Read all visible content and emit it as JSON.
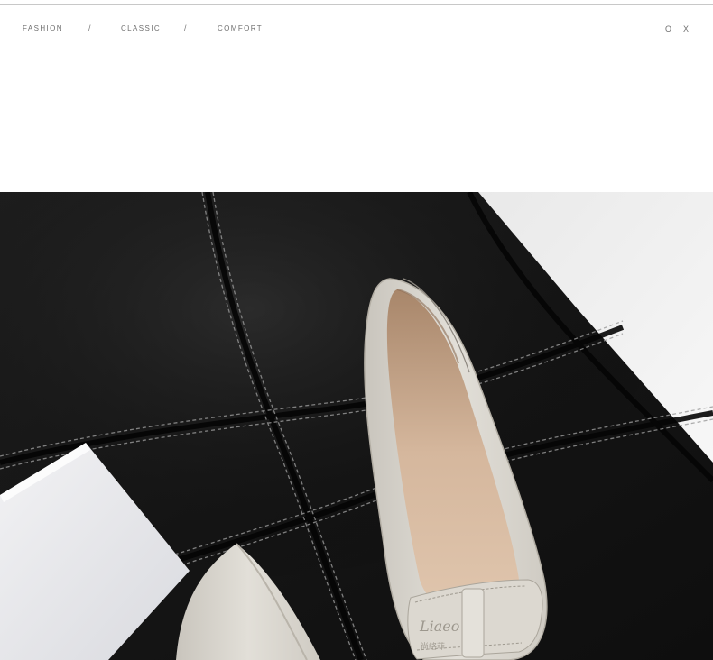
{
  "header": {
    "tags": [
      "FASHION",
      "CLASSIC",
      "COMFORT"
    ],
    "separator": "/",
    "corner_left": "O",
    "corner_right": "X"
  },
  "photo": {
    "bow_logo_text": "Liaeo",
    "bow_logo_subtext": "尚絡菲"
  }
}
